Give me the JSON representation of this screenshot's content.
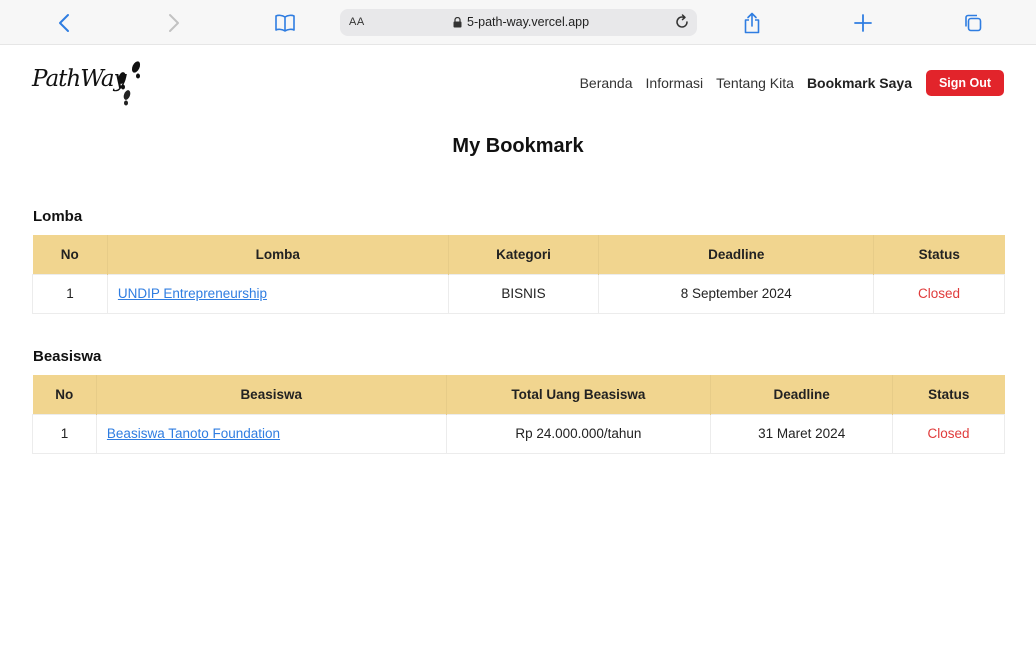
{
  "browser": {
    "aa_label": "AA",
    "url": "5-path-way.vercel.app"
  },
  "header": {
    "logo_text": "PathWay",
    "nav": [
      "Beranda",
      "Informasi",
      "Tentang Kita",
      "Bookmark Saya"
    ],
    "signout_label": "Sign Out"
  },
  "page_title": "My Bookmark",
  "lomba": {
    "title": "Lomba",
    "columns": [
      "No",
      "Lomba",
      "Kategori",
      "Deadline",
      "Status"
    ],
    "rows": [
      {
        "no": "1",
        "name": "UNDIP Entrepreneurship",
        "kategori": "BISNIS",
        "deadline": "8 September 2024",
        "status": "Closed"
      }
    ]
  },
  "beasiswa": {
    "title": "Beasiswa",
    "columns": [
      "No",
      "Beasiswa",
      "Total Uang Beasiswa",
      "Deadline",
      "Status"
    ],
    "rows": [
      {
        "no": "1",
        "name": "Beasiswa Tanoto Foundation",
        "total": "Rp 24.000.000/tahun",
        "deadline": "31 Maret 2024",
        "status": "Closed"
      }
    ]
  },
  "colors": {
    "accent": "#f1d58f",
    "signout": "#e2242b",
    "closed": "#e03b3b",
    "link": "#2f7de1"
  }
}
